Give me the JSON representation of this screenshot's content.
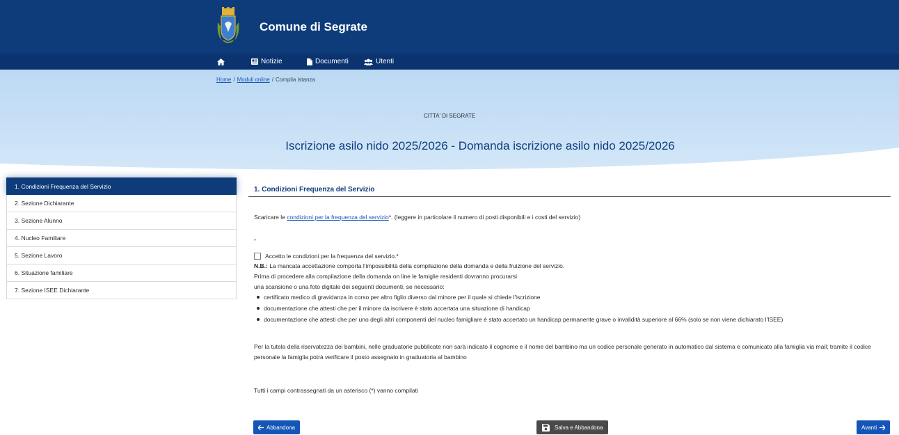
{
  "header": {
    "site_title": "Comune di Segrate"
  },
  "nav": {
    "items": [
      {
        "label": "",
        "icon": "home-icon"
      },
      {
        "label": "Notizie",
        "icon": "newspaper-icon"
      },
      {
        "label": "Documenti",
        "icon": "document-icon"
      },
      {
        "label": "Utenti",
        "icon": "users-icon"
      }
    ]
  },
  "breadcrumb": {
    "home": "Home",
    "sep": "/",
    "moduli": "Moduli online",
    "current": "Compila istanza"
  },
  "hero": {
    "ente": "CITTA' DI SEGRATE",
    "title": "Iscrizione asilo nido 2025/2026 - Domanda iscrizione asilo nido 2025/2026"
  },
  "steps": [
    {
      "label": "1. Condizioni Frequenza del Servizio",
      "active": true
    },
    {
      "label": "2. Sezione Dichiarante",
      "active": false
    },
    {
      "label": "3. Sezione Alunno",
      "active": false
    },
    {
      "label": "4. Nucleo Familiare",
      "active": false
    },
    {
      "label": "5. Sezione Lavoro",
      "active": false
    },
    {
      "label": "6. Situazione familiare",
      "active": false
    },
    {
      "label": "7. Sezione ISEE Dichiarante",
      "active": false
    }
  ],
  "section": {
    "title": "1. Condizioni Frequenza del Servizio",
    "download_prefix": "Scaricare le ",
    "download_link": "condizioni per la frequenza del servizio",
    "download_suffix": "*. (leggere in particolare il numero di posti disponibili e i costi del servizio)",
    "asterisk": "*",
    "checkbox_label": "Accetto le condizioni per la frequenza del servizio.*",
    "checkbox_checked": false,
    "nb_label": "N.B.:",
    "nb_text": " La mancata accettazione comporta l'impossibilità della compilazione della domanda e della fruizione del servizio.",
    "line_before": "Prima di procedere alla compilazione della domanda on line le famiglie residenti dovranno procurarsi",
    "line_scan": "una scansione o una foto digitale dei seguenti documenti, se necessario:",
    "bullets": [
      "certificato medico di gravidanza in corso per altro figlio diverso dal minore per il quale si chiede l'iscrizione",
      "documentazione che attesti che per il minore da iscrivere è stato accertata una situazione di handicap",
      "documentazione che attesti che per uno degli altri componenti del nucleo famigliare è stato accertato un handicap permanente grave o invalidità superiore al 66% (solo se non viene dichiarato l'ISEE)"
    ],
    "privacy": "Per la tutela della riservatezza dei bambini, nelle graduatorie pubblicate non sarà indicato il cognome e il nome del bambino ma un codice personale generato in automatico dal sistema e comunicato alla famiglia via mail; tramite il codice personale la famiglia potrà verificare il posto assegnato in graduatoria al bambino",
    "required_note": "Tutti i campi contrassegnati da un asterisco (*) vanno compilati"
  },
  "buttons": {
    "abandon": "Abbandona",
    "save_abandon": "Salva e Abbandona",
    "next": "Avanti"
  },
  "colors": {
    "primary": "#0e3c7a",
    "link": "#1456b8",
    "hero": "#c6dff6"
  }
}
